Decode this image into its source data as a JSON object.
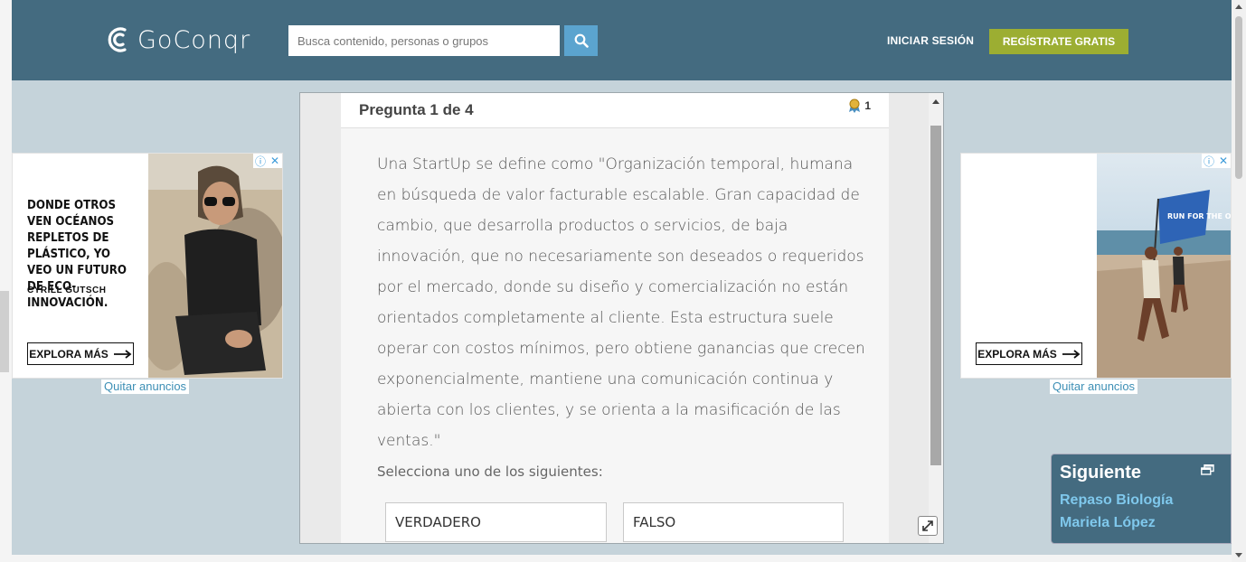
{
  "header": {
    "logo_text": "GoConqr",
    "search_placeholder": "Busca contenido, personas o grupos",
    "login_label": "INICIAR SESIÓN",
    "signup_label": "REGÍSTRATE GRATIS"
  },
  "ads": {
    "left": {
      "headline": "DONDE OTROS VEN OCÉANOS REPLETOS DE PLÁSTICO, YO VEO UN FUTURO DE ECO-INNOVACIÓN.",
      "author": "CYRILL GUTSCH",
      "cta": "EXPLORA MÁS"
    },
    "right": {
      "cta": "EXPLORA MÁS",
      "flag_text": "RUN FOR THE OCEANS"
    },
    "remove_label": "Quitar anuncios",
    "badge_info": "ⓘ",
    "badge_close": "✕"
  },
  "quiz": {
    "title": "Pregunta 1 de 4",
    "points": "1",
    "question": "Una StartUp se define como \"Organización temporal, humana en búsqueda de valor facturable escalable. Gran capacidad de cambio, que desarrolla productos o servicios, de baja innovación, que no necesariamente son deseados o requeridos por el mercado, donde su diseño y comercialización no están orientados completamente al cliente. Esta estructura suele operar con costos mínimos, pero obtiene ganancias que crecen exponencialmente, mantiene una comunicación continua y abierta con los clientes, y se orienta a la masificación de las ventas.\"",
    "prompt": "Selecciona uno de los siguientes:",
    "answers": [
      "VERDADERO",
      "FALSO"
    ]
  },
  "next_panel": {
    "title": "Siguiente",
    "links": [
      "Repaso Biología",
      "Mariela López"
    ]
  },
  "colors": {
    "header_bg": "#446b80",
    "page_bg": "#c5d3da",
    "accent_green": "#9cae32",
    "search_button": "#5ba4cf",
    "link_blue": "#7fc8ec"
  }
}
